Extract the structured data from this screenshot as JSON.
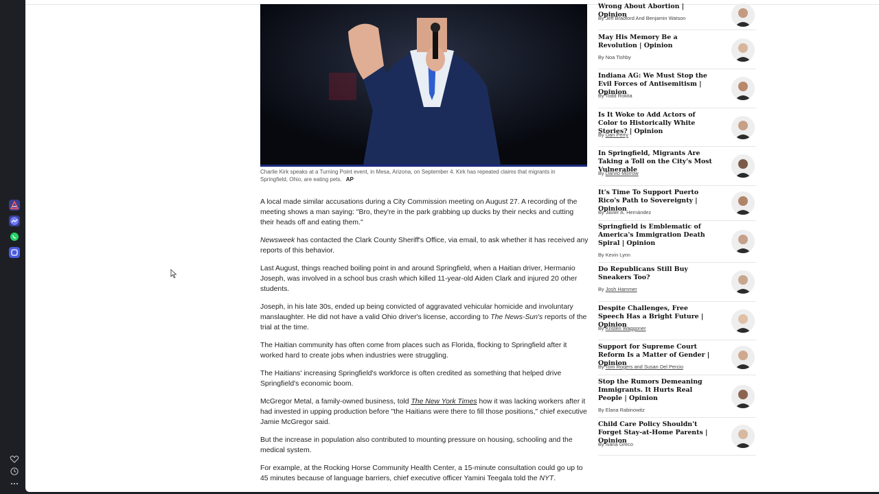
{
  "rail_icons": [
    "analytics-icon",
    "messenger-icon",
    "whatsapp-icon",
    "app-icon"
  ],
  "rail_bottom_icons": [
    "heart-icon",
    "clock-icon",
    "more-icon"
  ],
  "colors": {
    "accent_blue": "#1b2a80",
    "rail_bg": "#1e1f24"
  },
  "hero": {
    "caption": "Charlie Kirk speaks at a Turning Point event, in Mesa, Arizona, on September 4. Kirk has repeated claims that migrants in Springfield, Ohio, are eating pets.",
    "credit": "AP"
  },
  "article": {
    "p1": "A local made similar accusations during a City Commission meeting on August 27. A recording of the meeting shows a man saying: \"Bro, they're in the park grabbing up ducks by their necks and cutting their heads off and eating them.\"",
    "p2_em": "Newsweek",
    "p2_rest": " has contacted the Clark County Sheriff's Office, via email, to ask whether it has received any reports of this behavior.",
    "p3": "Last August, things reached boiling point in and around Springfield, when a Haitian driver, Hermanio Joseph, was involved in a school bus crash which killed 11-year-old Aiden Clark and injured 20 other students.",
    "p4_a": "Joseph, in his late 30s, ended up being convicted of aggravated vehicular homicide and involuntary manslaughter. He did not have a valid Ohio driver's license, according to ",
    "p4_em": "The News-Sun's",
    "p4_b": " reports of the trial at the time.",
    "p5": "The Haitian community has often come from places such as Florida, flocking to Springfield after it worked hard to create jobs when industries were struggling.",
    "p6": "The Haitians' increasing Springfield's workforce is often credited as something that helped drive Springfield's economic boom.",
    "p7_a": "McGregor Metal, a family-owned business, told ",
    "p7_link": "The New York Times",
    "p7_b": " how it was lacking workers after it had invested in upping production before \"the Haitians were there to fill those positions,\" chief executive Jamie McGregor said.",
    "p8": "But the increase in population also contributed to mounting pressure on housing, schooling and the medical system.",
    "p9_a": "For example, at the Rocking Horse Community Health Center, a 15-minute consultation could go up to 45 minutes because of language barriers, chief executive officer Yamini Teegala told the ",
    "p9_em": "NYT",
    "p9_b": "."
  },
  "sidebar": {
    "items": [
      {
        "title": "Wrong About Abortion | Opinion",
        "by": "By ",
        "author": "Jeff Bradford And Benjamin Watson",
        "link": false
      },
      {
        "title": "May His Memory Be a Revolution | Opinion",
        "by": "By ",
        "author": "Noa Tishby",
        "link": false
      },
      {
        "title": "Indiana AG: We Must Stop the Evil Forces of Antisemitism | Opinion",
        "by": "By ",
        "author": "Todd Rokita",
        "link": false
      },
      {
        "title": "Is It Woke to Add Actors of Color to Historically White Stories? | Opinion",
        "by": "By ",
        "author": "Dan Perry",
        "link": true
      },
      {
        "title": "In Springfield, Migrants Are Taking a Toll on the City's Most Vulnerable",
        "by": "By ",
        "author": "Darvio Morrow",
        "link": true
      },
      {
        "title": "It's Time To Support Puerto Rico's Path to Sovereignty | Opinion",
        "by": "By ",
        "author": "Javier A. Hernández",
        "link": false
      },
      {
        "title": "Springfield is Emblematic of America's Immigration Death Spiral | Opinion",
        "by": "By ",
        "author": "Kevin Lynn",
        "link": false
      },
      {
        "title": "Do Republicans Still Buy Sneakers Too?",
        "by": "By ",
        "author": "Josh Hammer",
        "link": true
      },
      {
        "title": "Despite Challenges, Free Speech Has a Bright Future | Opinion",
        "by": "By ",
        "author": "Kristen Waggoner",
        "link": true
      },
      {
        "title": "Support for Supreme Court Reform Is a Matter of Gender | Opinion",
        "by": "By ",
        "author": "Tom Rogers and Susan Del Percio",
        "link": true
      },
      {
        "title": "Stop the Rumors Demeaning Immigrants. It Hurts Real People | Opinion",
        "by": "By ",
        "author": "Elana Rabinowitz",
        "link": false
      },
      {
        "title": "Child Care Policy Shouldn't Forget Stay-at-Home Parents | Opinion",
        "by": "By ",
        "author": "Ivana Greco",
        "link": false
      }
    ]
  }
}
